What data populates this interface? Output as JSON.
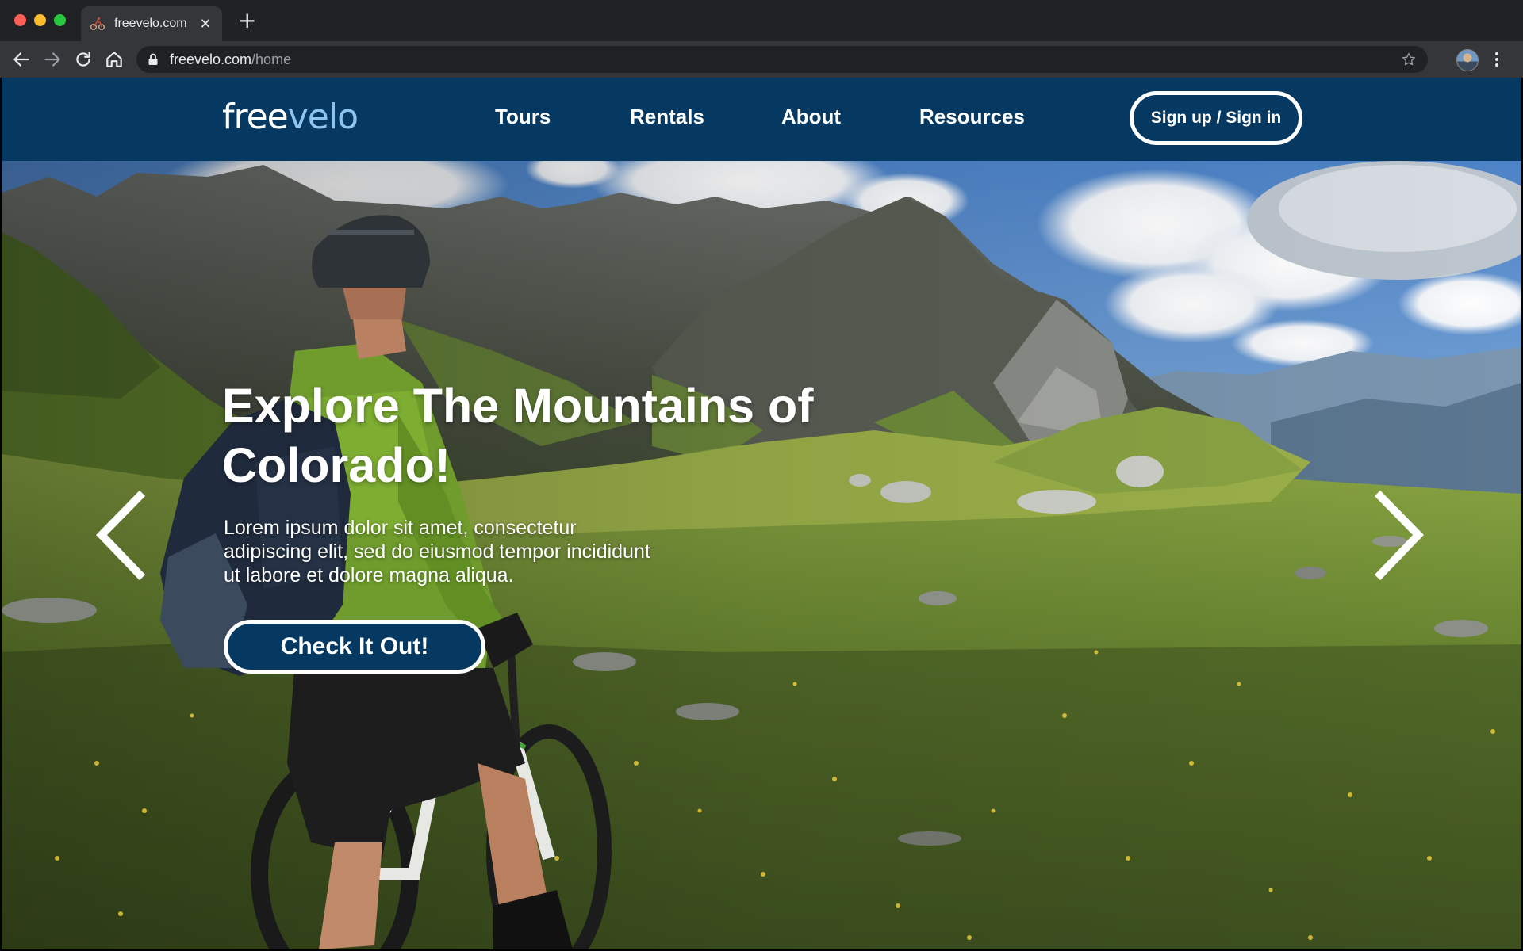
{
  "browser": {
    "tab_title": "freevelo.com",
    "tab_close": "✕",
    "new_tab": "+",
    "url_host": "freevelo.com",
    "url_path": "/home",
    "icons": {
      "back": "back-arrow-icon",
      "forward": "forward-arrow-icon",
      "reload": "reload-icon",
      "home": "home-icon",
      "lock": "lock-icon",
      "bookmark": "star-icon",
      "menu": "kebab-menu-icon"
    }
  },
  "site": {
    "logo": {
      "part1": "free",
      "part2": "velo"
    },
    "nav": {
      "items": [
        {
          "label": "Tours"
        },
        {
          "label": "Rentals"
        },
        {
          "label": "About"
        },
        {
          "label": "Resources"
        }
      ],
      "signup_label": "Sign up / Sign in"
    }
  },
  "hero": {
    "title": "Explore The Mountains of Colorado!",
    "body": "Lorem ipsum dolor sit amet, consectetur adipiscing elit, sed do eiusmod tempor incididunt ut labore et dolore magna aliqua.",
    "cta_label": "Check It Out!"
  },
  "colors": {
    "brand_navy": "#063961",
    "logo_accent": "#8fc4ee",
    "chrome_dark": "#202124",
    "chrome_tab": "#35363a"
  }
}
